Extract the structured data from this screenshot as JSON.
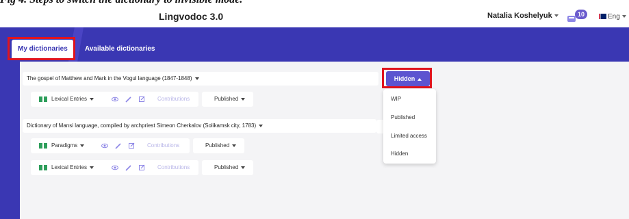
{
  "caption": "Fig 4. Steps to switch the dictionary to invisible mode.",
  "header": {
    "app_title": "Lingvodoc 3.0",
    "user_name": "Natalia Koshelyuk",
    "notification_count": "10",
    "language": "Eng"
  },
  "tabs": [
    {
      "label": "My dictionaries",
      "active": true
    },
    {
      "label": "Available dictionaries",
      "active": false
    }
  ],
  "dictionaries": [
    {
      "title": "The gospel of Matthew and Mark in the Vogul language (1847-1848)",
      "status": "Hidden",
      "perspectives": [
        {
          "name": "Lexical Entries",
          "contributions_label": "Contributions",
          "status": "Published"
        }
      ]
    },
    {
      "title": "Dictionary of Mansi language, compiled by archpriest Simeon Cherkalov (Solikamsk city, 1783)",
      "perspectives": [
        {
          "name": "Paradigms",
          "contributions_label": "Contributions",
          "status": "Published"
        },
        {
          "name": "Lexical Entries",
          "contributions_label": "Contributions",
          "status": "Published"
        }
      ]
    }
  ],
  "status_dropdown": {
    "options": [
      "WIP",
      "Published",
      "Limited access",
      "Hidden"
    ]
  },
  "colors": {
    "brand": "#3a37b3",
    "button": "#5c54d0",
    "highlight": "#e0141e",
    "book_icon": "#2e9e5b"
  },
  "icons": [
    "notifications-icon",
    "flag-uk-icon",
    "book-icon",
    "eye-icon",
    "pencil-icon",
    "edit-box-icon"
  ]
}
